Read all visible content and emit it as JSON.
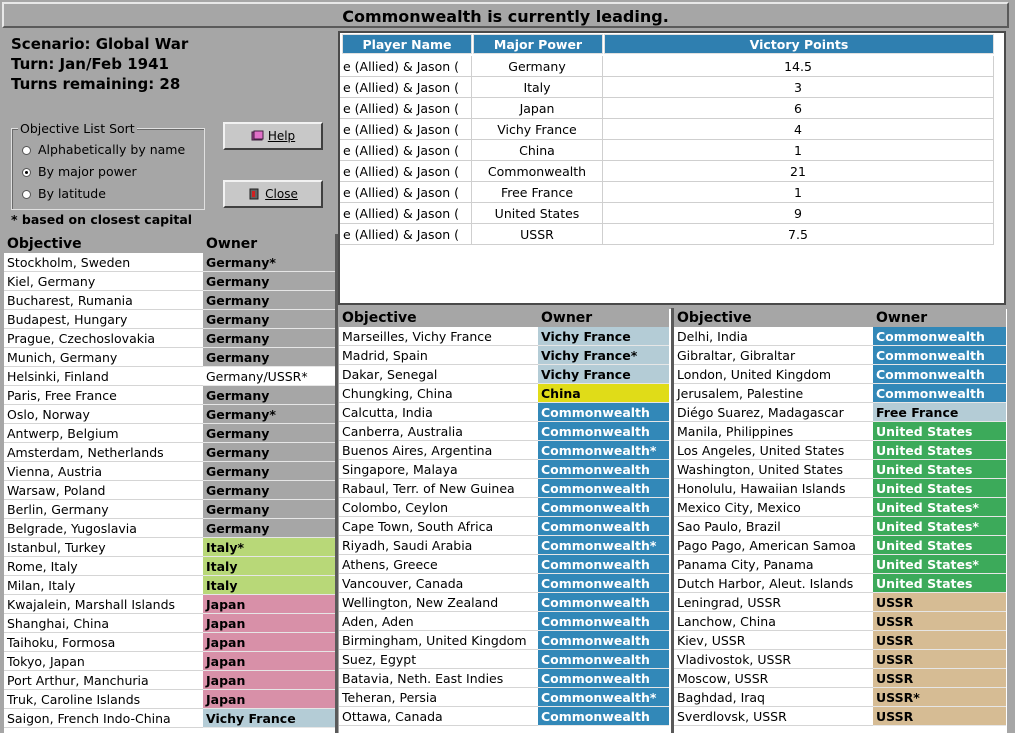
{
  "header": {
    "title": "Commonwealth is currently leading."
  },
  "scenario": {
    "line1": "Scenario: Global War",
    "line2": "Turn: Jan/Feb 1941",
    "line3": "Turns remaining: 28"
  },
  "sort": {
    "legend": "Objective List Sort",
    "options": [
      "Alphabetically by name",
      "By major power",
      "By latitude"
    ],
    "selected": 1
  },
  "note": "* based on closest capital",
  "buttons": {
    "help": "Help",
    "close": "Close"
  },
  "vp": {
    "headers": [
      "Player Name",
      "Major Power",
      "Victory Points"
    ],
    "rows": [
      [
        "e (Allied) & Jason (",
        "Germany",
        "14.5"
      ],
      [
        "e (Allied) & Jason (",
        "Italy",
        "3"
      ],
      [
        "e (Allied) & Jason (",
        "Japan",
        "6"
      ],
      [
        "e (Allied) & Jason (",
        "Vichy France",
        "4"
      ],
      [
        "e (Allied) & Jason (",
        "China",
        "1"
      ],
      [
        "e (Allied) & Jason (",
        "Commonwealth",
        "21"
      ],
      [
        "e (Allied) & Jason (",
        "Free France",
        "1"
      ],
      [
        "e (Allied) & Jason (",
        "United States",
        "9"
      ],
      [
        "e (Allied) & Jason (",
        "USSR",
        "7.5"
      ]
    ]
  },
  "colors": {
    "Germany": {
      "bg": "#a6a6a6",
      "fg": "#000000"
    },
    "Germany/USSR": {
      "bg": "#ffffff",
      "fg": "#000000",
      "bold": false
    },
    "Italy": {
      "bg": "#b8d878",
      "fg": "#000000"
    },
    "Japan": {
      "bg": "#d890a8",
      "fg": "#000000"
    },
    "Vichy France": {
      "bg": "#b4ccd6",
      "fg": "#000000"
    },
    "China": {
      "bg": "#e0dc18",
      "fg": "#000000"
    },
    "Commonwealth": {
      "bg": "#3288b8",
      "fg": "#ffffff"
    },
    "Free France": {
      "bg": "#b4ccd6",
      "fg": "#000000"
    },
    "United States": {
      "bg": "#3caa5a",
      "fg": "#ffffff"
    },
    "USSR": {
      "bg": "#d6bc94",
      "fg": "#000000"
    }
  },
  "objective_headers": {
    "objective": "Objective",
    "owner": "Owner"
  },
  "tables": [
    {
      "rows": [
        [
          "Stockholm, Sweden",
          "Germany",
          "*"
        ],
        [
          "Kiel, Germany",
          "Germany",
          ""
        ],
        [
          "Bucharest, Rumania",
          "Germany",
          ""
        ],
        [
          "Budapest, Hungary",
          "Germany",
          ""
        ],
        [
          "Prague, Czechoslovakia",
          "Germany",
          ""
        ],
        [
          "Munich, Germany",
          "Germany",
          ""
        ],
        [
          "Helsinki, Finland",
          "Germany/USSR",
          "*"
        ],
        [
          "Paris, Free France",
          "Germany",
          ""
        ],
        [
          "Oslo, Norway",
          "Germany",
          "*"
        ],
        [
          "Antwerp, Belgium",
          "Germany",
          ""
        ],
        [
          "Amsterdam, Netherlands",
          "Germany",
          ""
        ],
        [
          "Vienna, Austria",
          "Germany",
          ""
        ],
        [
          "Warsaw, Poland",
          "Germany",
          ""
        ],
        [
          "Berlin, Germany",
          "Germany",
          ""
        ],
        [
          "Belgrade, Yugoslavia",
          "Germany",
          ""
        ],
        [
          "Istanbul, Turkey",
          "Italy",
          "*"
        ],
        [
          "Rome, Italy",
          "Italy",
          ""
        ],
        [
          "Milan, Italy",
          "Italy",
          ""
        ],
        [
          "Kwajalein, Marshall Islands",
          "Japan",
          ""
        ],
        [
          "Shanghai, China",
          "Japan",
          ""
        ],
        [
          "Taihoku, Formosa",
          "Japan",
          ""
        ],
        [
          "Tokyo, Japan",
          "Japan",
          ""
        ],
        [
          "Port Arthur, Manchuria",
          "Japan",
          ""
        ],
        [
          "Truk, Caroline Islands",
          "Japan",
          ""
        ],
        [
          "Saigon, French Indo-China",
          "Vichy France",
          ""
        ]
      ]
    },
    {
      "rows": [
        [
          "Marseilles, Vichy France",
          "Vichy France",
          ""
        ],
        [
          "Madrid, Spain",
          "Vichy France",
          "*"
        ],
        [
          "Dakar, Senegal",
          "Vichy France",
          ""
        ],
        [
          "Chungking, China",
          "China",
          ""
        ],
        [
          "Calcutta, India",
          "Commonwealth",
          ""
        ],
        [
          "Canberra, Australia",
          "Commonwealth",
          ""
        ],
        [
          "Buenos Aires, Argentina",
          "Commonwealth",
          "*"
        ],
        [
          "Singapore, Malaya",
          "Commonwealth",
          ""
        ],
        [
          "Rabaul, Terr. of New Guinea",
          "Commonwealth",
          ""
        ],
        [
          "Colombo, Ceylon",
          "Commonwealth",
          ""
        ],
        [
          "Cape Town, South Africa",
          "Commonwealth",
          ""
        ],
        [
          "Riyadh, Saudi Arabia",
          "Commonwealth",
          "*"
        ],
        [
          "Athens, Greece",
          "Commonwealth",
          ""
        ],
        [
          "Vancouver, Canada",
          "Commonwealth",
          ""
        ],
        [
          "Wellington, New Zealand",
          "Commonwealth",
          ""
        ],
        [
          "Aden, Aden",
          "Commonwealth",
          ""
        ],
        [
          "Birmingham, United Kingdom",
          "Commonwealth",
          ""
        ],
        [
          "Suez, Egypt",
          "Commonwealth",
          ""
        ],
        [
          "Batavia, Neth. East Indies",
          "Commonwealth",
          ""
        ],
        [
          "Teheran, Persia",
          "Commonwealth",
          "*"
        ],
        [
          "Ottawa, Canada",
          "Commonwealth",
          ""
        ]
      ]
    },
    {
      "rows": [
        [
          "Delhi, India",
          "Commonwealth",
          ""
        ],
        [
          "Gibraltar, Gibraltar",
          "Commonwealth",
          ""
        ],
        [
          "London, United Kingdom",
          "Commonwealth",
          ""
        ],
        [
          "Jerusalem, Palestine",
          "Commonwealth",
          ""
        ],
        [
          "Diégo Suarez, Madagascar",
          "Free France",
          ""
        ],
        [
          "Manila, Philippines",
          "United States",
          ""
        ],
        [
          "Los Angeles, United States",
          "United States",
          ""
        ],
        [
          "Washington, United States",
          "United States",
          ""
        ],
        [
          "Honolulu, Hawaiian Islands",
          "United States",
          ""
        ],
        [
          "Mexico City, Mexico",
          "United States",
          "*"
        ],
        [
          "Sao Paulo, Brazil",
          "United States",
          "*"
        ],
        [
          "Pago Pago, American Samoa",
          "United States",
          ""
        ],
        [
          "Panama City, Panama",
          "United States",
          "*"
        ],
        [
          "Dutch Harbor, Aleut. Islands",
          "United States",
          ""
        ],
        [
          "Leningrad, USSR",
          "USSR",
          ""
        ],
        [
          "Lanchow, China",
          "USSR",
          ""
        ],
        [
          "Kiev, USSR",
          "USSR",
          ""
        ],
        [
          "Vladivostok, USSR",
          "USSR",
          ""
        ],
        [
          "Moscow, USSR",
          "USSR",
          ""
        ],
        [
          "Baghdad, Iraq",
          "USSR",
          "*"
        ],
        [
          "Sverdlovsk, USSR",
          "USSR",
          ""
        ]
      ]
    }
  ]
}
